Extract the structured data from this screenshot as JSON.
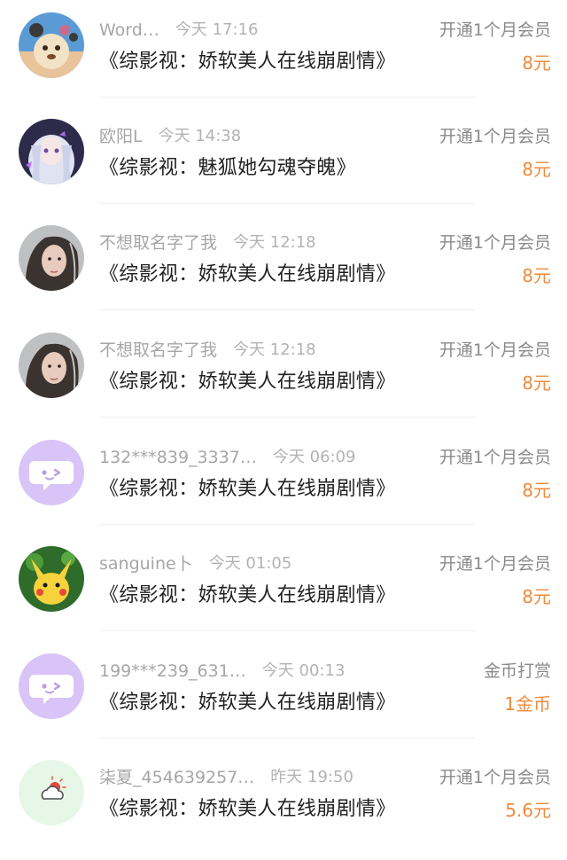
{
  "rows": [
    {
      "username": "Word…",
      "time": "今天 17:16",
      "action": "开通1个月会员",
      "book": "《综影视：娇软美人在线崩剧情》",
      "amount": "8元",
      "avatar": "dog-cartoon-avatar"
    },
    {
      "username": "欧阳L",
      "time": "今天 14:38",
      "action": "开通1个月会员",
      "book": "《综影视：魅狐她勾魂夺魄》",
      "amount": "8元",
      "avatar": "anime-girl-avatar"
    },
    {
      "username": "不想取名字了我",
      "time": "今天 12:18",
      "action": "开通1个月会员",
      "book": "《综影视：娇软美人在线崩剧情》",
      "amount": "8元",
      "avatar": "portrait-girl-avatar"
    },
    {
      "username": "不想取名字了我",
      "time": "今天 12:18",
      "action": "开通1个月会员",
      "book": "《综影视：娇软美人在线崩剧情》",
      "amount": "8元",
      "avatar": "portrait-girl-avatar"
    },
    {
      "username": "132***839_3337…",
      "time": "今天 06:09",
      "action": "开通1个月会员",
      "book": "《综影视：娇软美人在线崩剧情》",
      "amount": "8元",
      "avatar": "default-chat-avatar"
    },
    {
      "username": "sanguine卜",
      "time": "今天 01:05",
      "action": "开通1个月会员",
      "book": "《综影视：娇软美人在线崩剧情》",
      "amount": "8元",
      "avatar": "pikachu-avatar"
    },
    {
      "username": "199***239_631…",
      "time": "今天 00:13",
      "action": "金币打赏",
      "book": "《综影视：娇软美人在线崩剧情》",
      "amount": "1金币",
      "avatar": "default-chat-avatar"
    },
    {
      "username": "柒夏_454639257…",
      "time": "昨天 19:50",
      "action": "开通1个月会员",
      "book": "《综影视：娇软美人在线崩剧情》",
      "amount": "5.6元",
      "avatar": "weather-cloud-avatar"
    }
  ],
  "colors": {
    "amount": "#f08a3c",
    "meta": "#a6a6a6",
    "title": "#222222",
    "default_avatar_bg": "#d9c4f7"
  }
}
